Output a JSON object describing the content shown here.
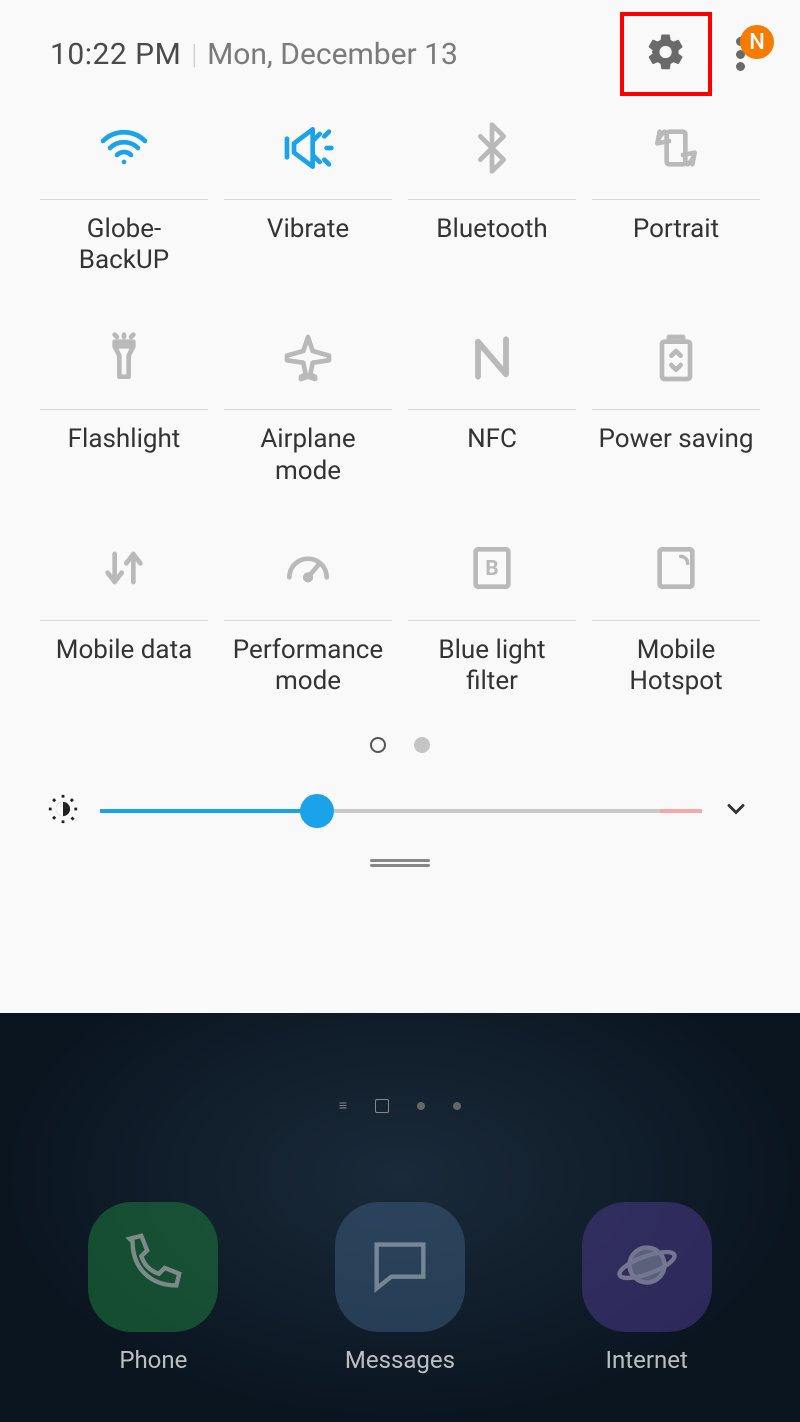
{
  "header": {
    "time": "10:22 PM",
    "date": "Mon, December 13",
    "badge_letter": "N"
  },
  "tiles": [
    {
      "id": "wifi",
      "label": "Globe-BackUP",
      "active": true
    },
    {
      "id": "vibrate",
      "label": "Vibrate",
      "active": true
    },
    {
      "id": "bluetooth",
      "label": "Bluetooth",
      "active": false
    },
    {
      "id": "rotation",
      "label": "Portrait",
      "active": false
    },
    {
      "id": "flashlight",
      "label": "Flashlight",
      "active": false
    },
    {
      "id": "airplane",
      "label": "Airplane mode",
      "active": false
    },
    {
      "id": "nfc",
      "label": "NFC",
      "active": false
    },
    {
      "id": "power",
      "label": "Power saving",
      "active": false
    },
    {
      "id": "mobiledata",
      "label": "Mobile data",
      "active": false
    },
    {
      "id": "performance",
      "label": "Performance mode",
      "active": false
    },
    {
      "id": "bluelight",
      "label": "Blue light filter",
      "active": false
    },
    {
      "id": "hotspot",
      "label": "Mobile Hotspot",
      "active": false
    }
  ],
  "brightness": {
    "percent": 36
  },
  "pager": {
    "current": 0,
    "total": 2
  },
  "dock": [
    {
      "id": "phone",
      "label": "Phone"
    },
    {
      "id": "messages",
      "label": "Messages"
    },
    {
      "id": "internet",
      "label": "Internet"
    }
  ],
  "colors": {
    "accent": "#1aa3e8",
    "inactive": "#b9b9b9",
    "badge": "#f57c00",
    "highlight_box": "#ff0000"
  }
}
